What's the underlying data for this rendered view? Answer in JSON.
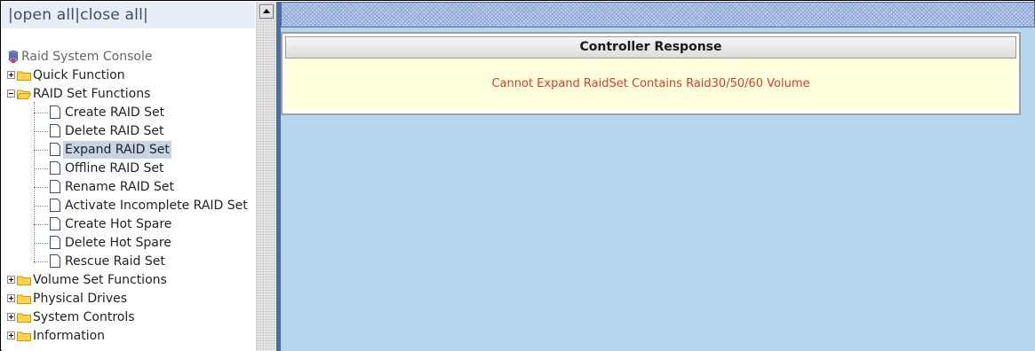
{
  "tree_header": {
    "open_all": "open all",
    "close_all": "close all",
    "text": "|open all|close all|"
  },
  "tree": {
    "root": "Raid System Console",
    "folders": [
      {
        "label": "Quick Function",
        "expanded": false
      },
      {
        "label": "RAID Set Functions",
        "expanded": true
      },
      {
        "label": "Volume Set Functions",
        "expanded": false
      },
      {
        "label": "Physical Drives",
        "expanded": false
      },
      {
        "label": "System Controls",
        "expanded": false
      },
      {
        "label": "Information",
        "expanded": false
      }
    ],
    "raid_set_items": [
      "Create RAID Set",
      "Delete RAID Set",
      "Expand RAID Set",
      "Offline RAID Set",
      "Rename RAID Set",
      "Activate Incomplete RAID Set",
      "Create Hot Spare",
      "Delete Hot Spare",
      "Rescue Raid Set"
    ],
    "selected_item": "Expand RAID Set"
  },
  "response": {
    "title": "Controller Response",
    "message": "Cannot Expand RaidSet Contains Raid30/50/60 Volume"
  },
  "colors": {
    "right_background": "#b6d6ee",
    "message_text": "#e23b2a",
    "message_background": "#ffffdd",
    "divider": "#4d6e9e"
  }
}
